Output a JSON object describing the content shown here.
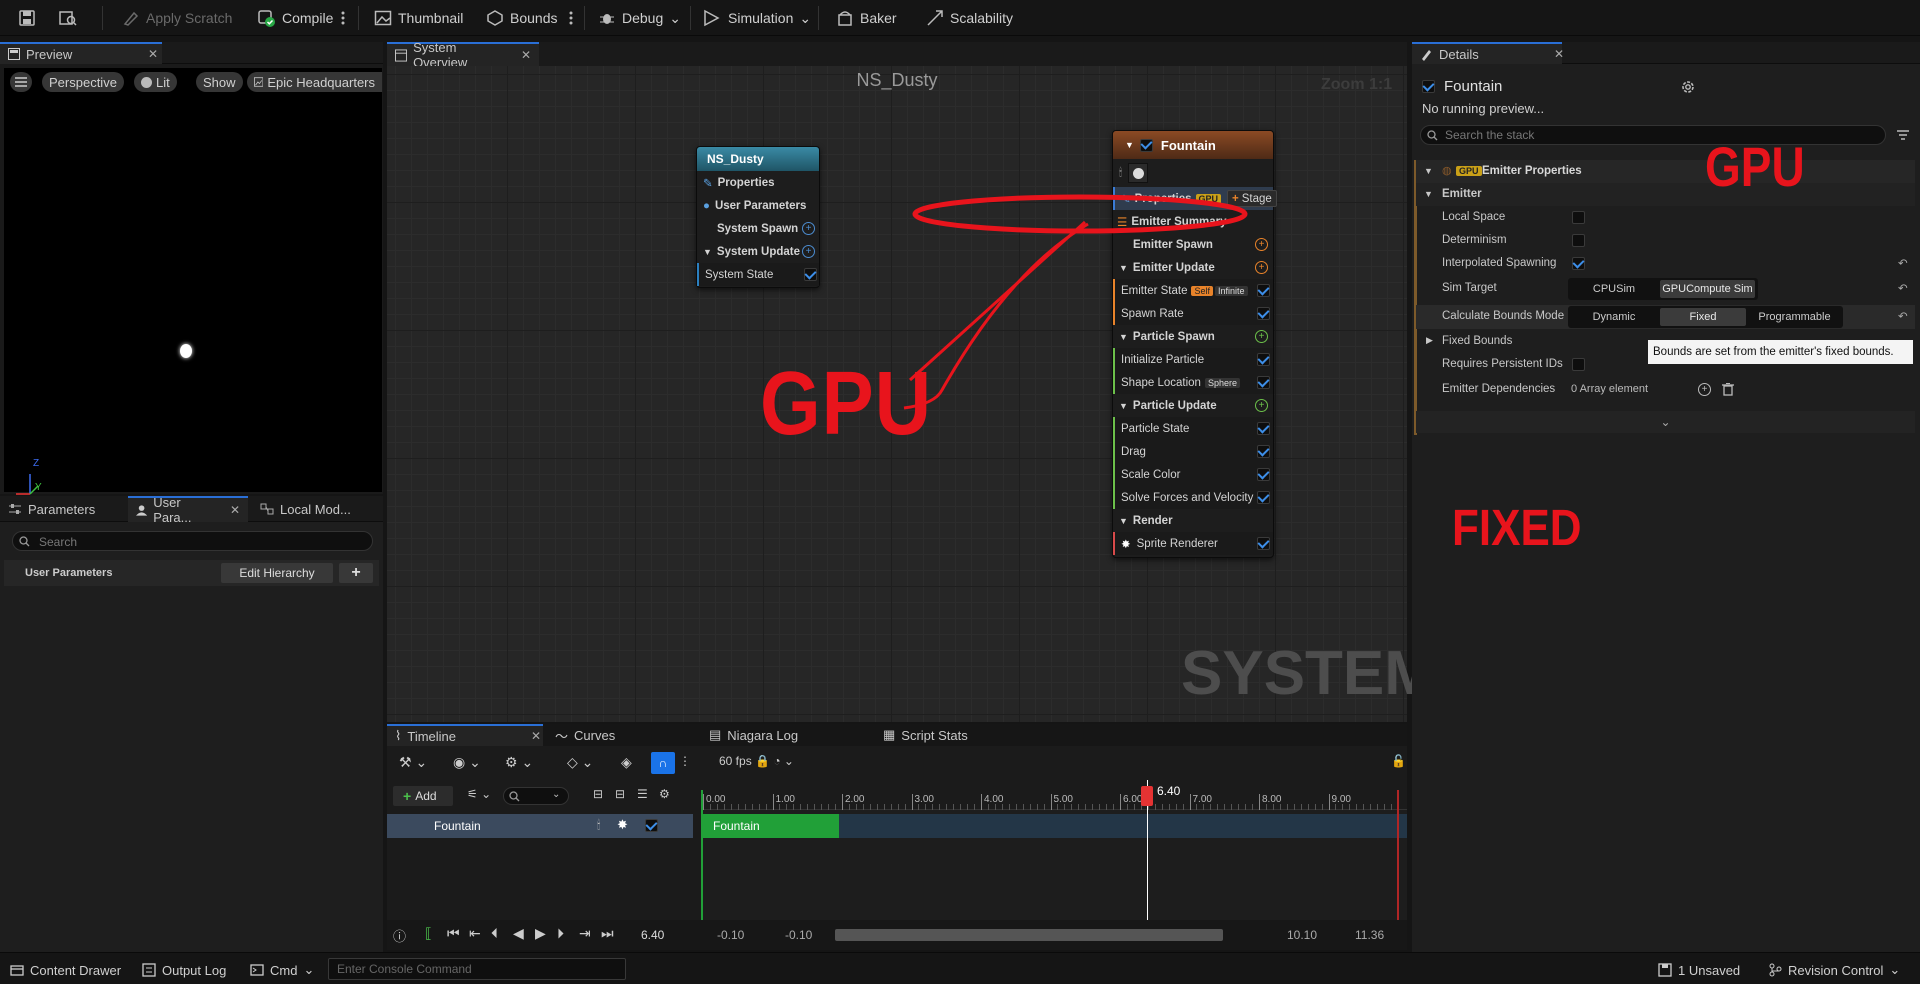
{
  "toolbar": {
    "apply_scratch": "Apply Scratch",
    "compile": "Compile",
    "thumbnail": "Thumbnail",
    "bounds": "Bounds",
    "debug": "Debug",
    "simulation": "Simulation",
    "baker": "Baker",
    "scalability": "Scalability"
  },
  "preview": {
    "tab": "Preview",
    "perspective": "Perspective",
    "lit": "Lit",
    "show": "Show",
    "environment": "Epic Headquarters",
    "axis_z": "Z",
    "axis_y": "Y"
  },
  "params": {
    "tabs": [
      "Parameters",
      "User Para...",
      "Local Mod..."
    ],
    "search_placeholder": "Search",
    "section": "User Parameters",
    "edit_hierarchy": "Edit Hierarchy",
    "add": "+"
  },
  "overview": {
    "tab": "System Overview",
    "title": "NS_Dusty",
    "zoom": "Zoom 1:1",
    "watermark": "SYSTEM",
    "system_node": {
      "title": "NS_Dusty",
      "rows": [
        "Properties",
        "User Parameters",
        "System Spawn",
        "System Update",
        "System State"
      ]
    },
    "emitter_node": {
      "title": "Fountain",
      "properties": "Properties",
      "gpu_tag": "GPU",
      "stage": "Stage",
      "summary": "Emitter Summary",
      "emitter_spawn": "Emitter Spawn",
      "emitter_update": "Emitter Update",
      "emitter_state": "Emitter State",
      "self_tag": "Self",
      "infinite_tag": "Infinite",
      "spawn_rate": "Spawn Rate",
      "particle_spawn": "Particle Spawn",
      "initialize_particle": "Initialize Particle",
      "shape_location": "Shape Location",
      "sphere_tag": "Sphere",
      "particle_update": "Particle Update",
      "particle_state": "Particle State",
      "drag": "Drag",
      "scale_color": "Scale Color",
      "solve_forces": "Solve Forces and Velocity",
      "render": "Render",
      "sprite_renderer": "Sprite Renderer"
    },
    "annotation_gpu": "GPU"
  },
  "details": {
    "tab": "Details",
    "emitter_name": "Fountain",
    "no_preview": "No running preview...",
    "search_placeholder": "Search the stack",
    "section": "Emitter Properties",
    "section_tag": "GPU",
    "category": "Emitter",
    "local_space": "Local Space",
    "determinism": "Determinism",
    "interpolated_spawning": "Interpolated Spawning",
    "sim_target": "Sim Target",
    "sim_cpu": "CPUSim",
    "sim_gpu": "GPUCompute Sim",
    "bounds_mode": "Calculate Bounds Mode",
    "bounds_dynamic": "Dynamic",
    "bounds_fixed": "Fixed",
    "bounds_programmable": "Programmable",
    "fixed_bounds": "Fixed Bounds",
    "tooltip": "Bounds are set from the emitter's fixed bounds.",
    "requires_ids": "Requires Persistent IDs",
    "dependencies": "Emitter Dependencies",
    "array_elements": "0 Array element",
    "annotation_gpu": "GPU",
    "annotation_fixed": "FIXED"
  },
  "timeline": {
    "tabs": [
      "Timeline",
      "Curves",
      "Niagara Log",
      "Script Stats"
    ],
    "fps": "60 fps",
    "add": "Add",
    "track": "Fountain",
    "clip": "Fountain",
    "playhead": "6.40",
    "current_time": "6.40",
    "ticks": [
      "0.00",
      "1.00",
      "2.00",
      "3.00",
      "4.00",
      "5.00",
      "6.00",
      "7.00",
      "8.00",
      "9.00"
    ],
    "range_start_a": "-0.10",
    "range_start_b": "-0.10",
    "range_end_a": "10.10",
    "range_end_b": "11.36"
  },
  "statusbar": {
    "content_drawer": "Content Drawer",
    "output_log": "Output Log",
    "cmd": "Cmd",
    "console_placeholder": "Enter Console Command",
    "unsaved": "1 Unsaved",
    "revision": "Revision Control"
  },
  "colors": {
    "accent": "#2a6fd6",
    "annotation_red": "#e8141c",
    "emitter_header": "#6b3a1f",
    "system_header": "#2d6f86",
    "clip_green": "#21a038"
  }
}
